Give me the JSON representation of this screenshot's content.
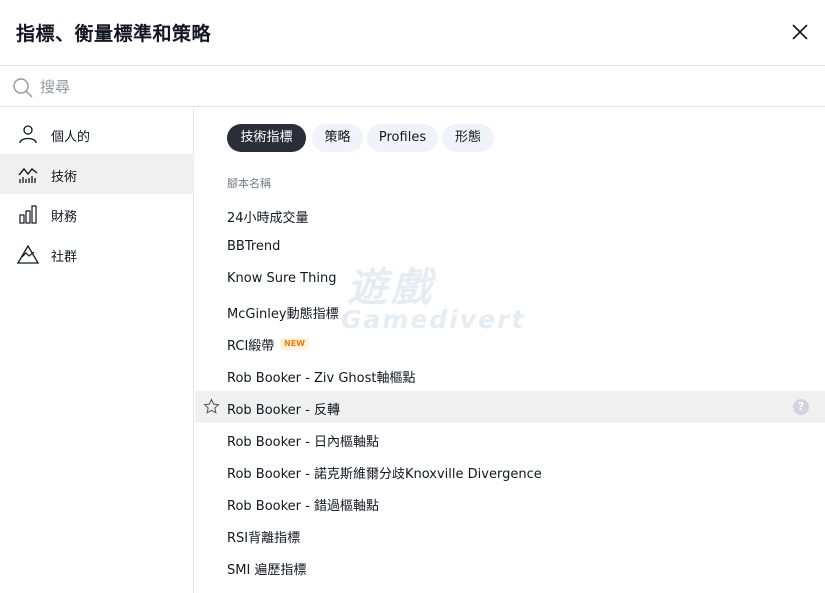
{
  "header": {
    "title": "指標、衡量標準和策略"
  },
  "search": {
    "placeholder": "搜尋"
  },
  "sidebar": {
    "items": [
      {
        "label": "個人的",
        "icon": "person-icon"
      },
      {
        "label": "技術",
        "icon": "chart-line-icon",
        "active": true
      },
      {
        "label": "財務",
        "icon": "bar-chart-icon"
      },
      {
        "label": "社群",
        "icon": "community-icon"
      }
    ]
  },
  "tabs": [
    {
      "label": "技術指標",
      "active": true
    },
    {
      "label": "策略"
    },
    {
      "label": "Profiles"
    },
    {
      "label": "形態"
    }
  ],
  "list": {
    "column_header": "腳本名稱",
    "items": [
      {
        "label": "24小時成交量"
      },
      {
        "label": "BBTrend"
      },
      {
        "label": "Know Sure Thing"
      },
      {
        "label": "McGinley動態指標"
      },
      {
        "label": "RCI緞帶",
        "badge": "NEW"
      },
      {
        "label": "Rob Booker - Ziv Ghost軸樞點"
      },
      {
        "label": "Rob Booker - 反轉",
        "hovered": true
      },
      {
        "label": "Rob Booker - 日內樞軸點"
      },
      {
        "label": "Rob Booker - 諾克斯維爾分歧Knoxville Divergence"
      },
      {
        "label": "Rob Booker - 錯過樞軸點"
      },
      {
        "label": "RSI背離指標"
      },
      {
        "label": "SMI 遍歷指標"
      }
    ]
  },
  "watermark": {
    "top": "遊戲",
    "bottom": "Gamedivert"
  },
  "colors": {
    "accent": "#2a2e39",
    "badge_text": "#f57c00",
    "badge_bg": "#fff3e0",
    "hover_bg": "#f0f0f0"
  }
}
